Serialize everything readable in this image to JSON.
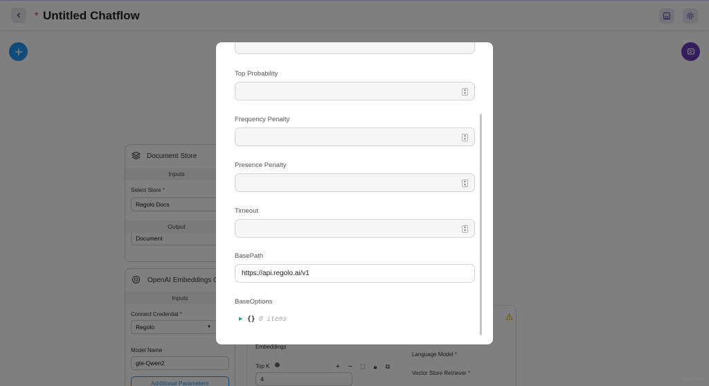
{
  "header": {
    "title": "Untitled Chatflow",
    "unsaved_marker": "*"
  },
  "canvas": {
    "nodes": {
      "document_store": {
        "title": "Document Store",
        "inputs_label": "Inputs",
        "select_store_label": "Select Store",
        "select_store_value": "Regolo Docs",
        "output_label": "Output",
        "output_value": "Document"
      },
      "embeddings": {
        "title": "OpenAI Embeddings Cus",
        "inputs_label": "Inputs",
        "credential_label": "Connect Credential",
        "credential_value": "Regolo",
        "model_label": "Model Name",
        "model_value": "gte-Qwen2",
        "additional_params": "Additional Parameters"
      },
      "retriever": {
        "embeddings_label": "Embeddings",
        "top_k_label": "Top K",
        "top_k_value": "4",
        "language_model_label": "Language Model",
        "vector_store_label": "Vector Store Retriever"
      }
    },
    "attribution": "React Flow"
  },
  "modal": {
    "fields": [
      {
        "label": "Top Probability",
        "value": ""
      },
      {
        "label": "Frequency Penalty",
        "value": ""
      },
      {
        "label": "Presence Penalty",
        "value": ""
      },
      {
        "label": "Timeout",
        "value": ""
      },
      {
        "label": "BasePath",
        "value": "https://api.regolo.ai/v1"
      },
      {
        "label": "BaseOptions",
        "json_braces": "{}",
        "json_count": "0 items"
      }
    ]
  },
  "colors": {
    "accent_blue": "#2196f3",
    "accent_purple": "#673ab7",
    "required_red": "#d32f2f"
  }
}
